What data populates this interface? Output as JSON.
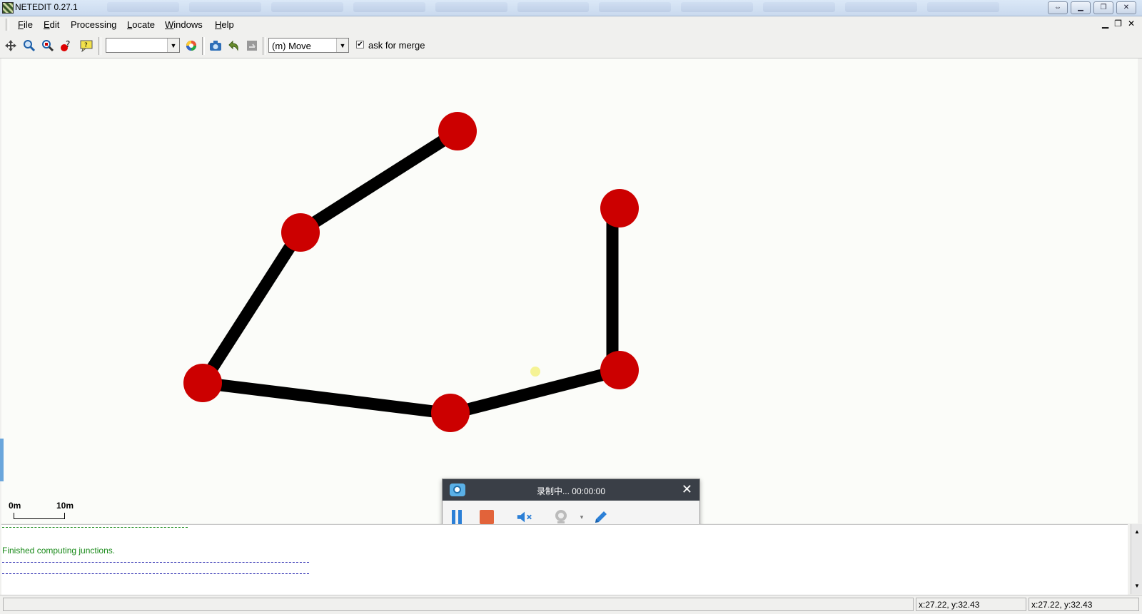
{
  "window": {
    "title": "NETEDIT 0.27.1"
  },
  "menu": [
    {
      "label": "File",
      "ul": "F",
      "rest": "ile"
    },
    {
      "label": "Edit",
      "ul": "E",
      "rest": "dit"
    },
    {
      "label": "Processing",
      "ul": "",
      "rest": "Processing"
    },
    {
      "label": "Locate",
      "ul": "L",
      "rest": "ocate"
    },
    {
      "label": "Windows",
      "ul": "W",
      "rest": "indows"
    },
    {
      "label": "Help",
      "ul": "H",
      "rest": "elp"
    }
  ],
  "toolbar": {
    "view_combo_value": "",
    "mode_combo_value": "(m) Move",
    "merge_label": "ask for merge",
    "merge_checked": true,
    "icons": [
      "recenter-view-icon",
      "zoom-icon",
      "locate-junction-icon",
      "inspect-icon",
      "tooltip-icon"
    ],
    "icons2": [
      "color-scheme-icon",
      "screenshot-icon",
      "undo-icon",
      "redo-icon"
    ]
  },
  "canvas": {
    "scale_start": "0m",
    "scale_end": "10m",
    "edge_color": "#000000",
    "junction_color": "#cc0000"
  },
  "recorder": {
    "title": "录制中... 00:00:00",
    "tools": [
      "pause-icon",
      "stop-icon",
      "mute-icon",
      "webcam-icon",
      "pen-icon"
    ]
  },
  "log": {
    "message": "Finished computing junctions.",
    "message_color": "#1a8a1a"
  },
  "status": {
    "coords_1": "x:27.22, y:32.43",
    "coords_2": "x:27.22, y:32.43"
  }
}
